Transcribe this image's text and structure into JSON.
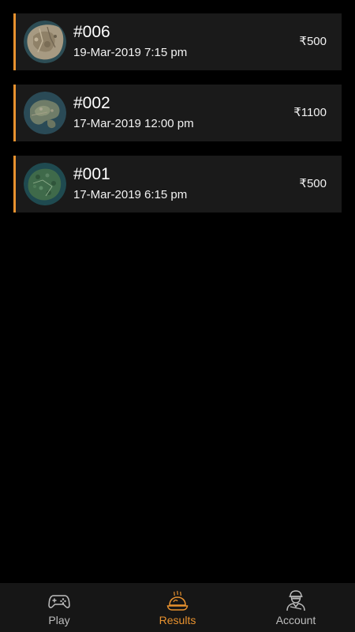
{
  "results": [
    {
      "id": "#006",
      "datetime": "19-Mar-2019 7:15 pm",
      "prize": "₹500",
      "map": "desert-map"
    },
    {
      "id": "#002",
      "datetime": "17-Mar-2019 12:00 pm",
      "prize": "₹1100",
      "map": "island-map"
    },
    {
      "id": "#001",
      "datetime": "17-Mar-2019 6:15 pm",
      "prize": "₹500",
      "map": "jungle-map"
    }
  ],
  "nav": {
    "play": {
      "label": "Play",
      "icon": "gamepad-icon"
    },
    "results": {
      "label": "Results",
      "icon": "chicken-dinner-icon"
    },
    "account": {
      "label": "Account",
      "icon": "soldier-icon"
    }
  },
  "colors": {
    "accent": "#e8922f",
    "card_background": "#1a1a1a",
    "nav_background": "#161616"
  }
}
